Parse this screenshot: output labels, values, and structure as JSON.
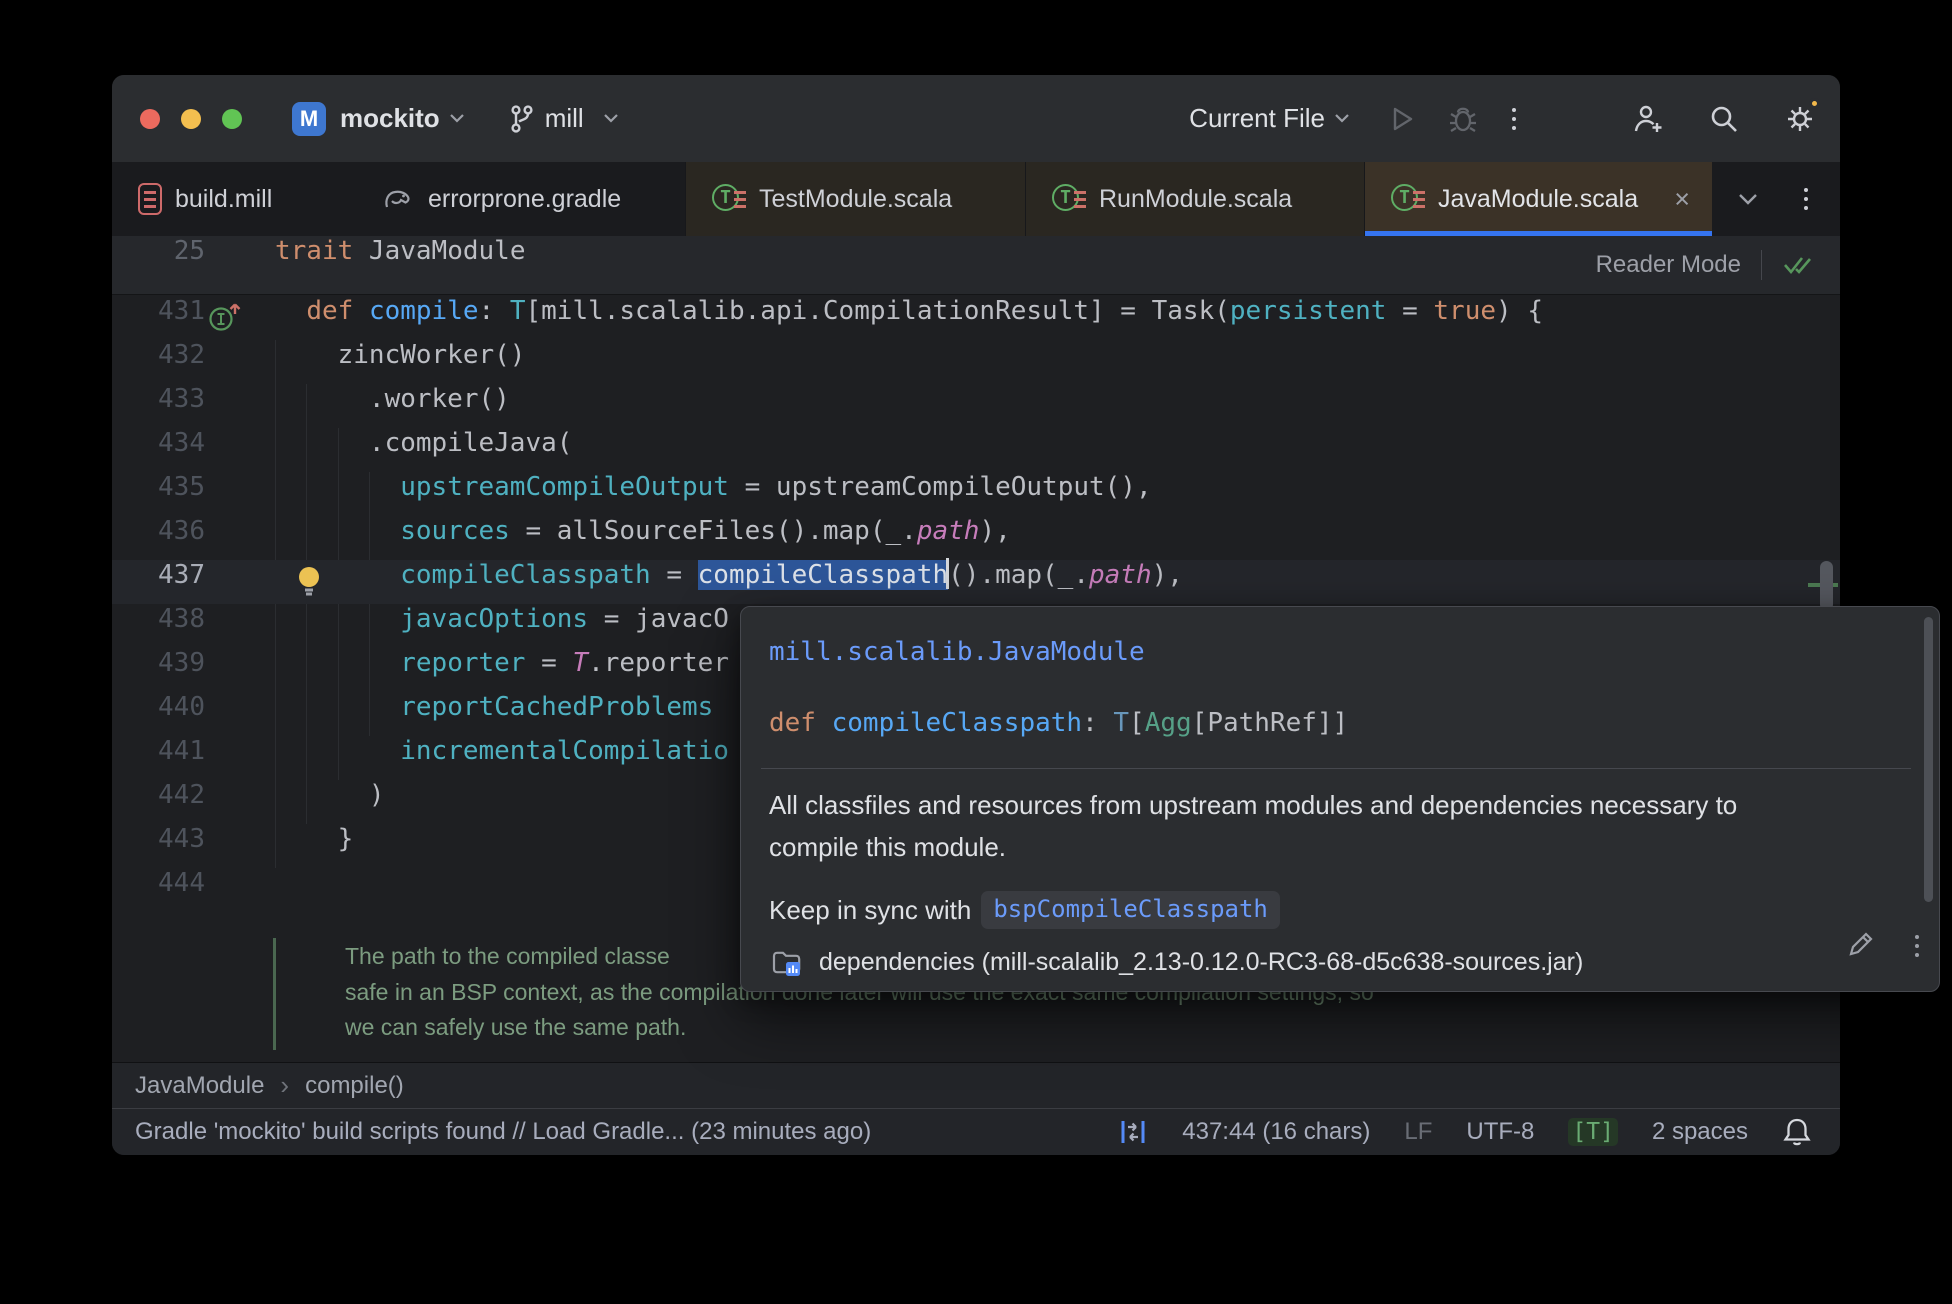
{
  "window": {
    "title_project": "mockito",
    "vcs_branch": "mill",
    "run_config": "Current File"
  },
  "colors": {
    "accent_blue": "#3574F0",
    "selection": "#2D5699",
    "link_blue": "#6B9BFA",
    "scala_green": "#5FAD65",
    "salmon": "#CC7168",
    "notification_dot": "#F2B84B"
  },
  "tabs": {
    "close_glyph": "×",
    "items": [
      {
        "label": "build.mill",
        "icon": "mill-file-icon"
      },
      {
        "label": "errorprone.gradle",
        "icon": "gradle-icon"
      },
      {
        "label": "TestModule.scala",
        "icon": "scala-trait-icon"
      },
      {
        "label": "RunModule.scala",
        "icon": "scala-trait-icon"
      },
      {
        "label": "JavaModule.scala",
        "icon": "scala-trait-icon",
        "active": true
      }
    ]
  },
  "sticky": {
    "line_number": "25",
    "keyword": "trait",
    "name": " JavaModule",
    "reader_mode": "Reader Mode"
  },
  "editor": {
    "lines": [
      {
        "n": "431",
        "gutter": "override-marker",
        "t": [
          [
            "pl",
            "  "
          ],
          [
            "kw",
            "def"
          ],
          [
            "pl",
            " "
          ],
          [
            "fn",
            "compile"
          ],
          [
            "pl",
            ": "
          ],
          [
            "ty",
            "T"
          ],
          [
            "pl",
            "[mill.scalalib.api.CompilationResult] = Task("
          ],
          [
            "nm",
            "persistent"
          ],
          [
            "pl",
            " = "
          ],
          [
            "kw",
            "true"
          ],
          [
            "pl",
            ") {"
          ]
        ]
      },
      {
        "n": "432",
        "t": [
          [
            "pl",
            "    zincWorker()"
          ]
        ]
      },
      {
        "n": "433",
        "t": [
          [
            "pl",
            "      .worker()"
          ]
        ]
      },
      {
        "n": "434",
        "t": [
          [
            "pl",
            "      .compileJava("
          ]
        ]
      },
      {
        "n": "435",
        "t": [
          [
            "pl",
            "        "
          ],
          [
            "nm",
            "upstreamCompileOutput"
          ],
          [
            "pl",
            " = upstreamCompileOutput(),"
          ]
        ]
      },
      {
        "n": "436",
        "t": [
          [
            "pl",
            "        "
          ],
          [
            "nm",
            "sources"
          ],
          [
            "pl",
            " = allSourceFiles().map(_."
          ],
          [
            "it",
            "path"
          ],
          [
            "pl",
            "),"
          ]
        ]
      },
      {
        "n": "437",
        "current": true,
        "gutter": "lightbulb",
        "t": [
          [
            "pl",
            "        "
          ],
          [
            "nm",
            "compileClasspath"
          ],
          [
            "pl",
            " = "
          ],
          [
            "sel",
            "compileClasspath"
          ],
          [
            "cur",
            ""
          ],
          [
            "pl",
            "().map(_."
          ],
          [
            "it",
            "path"
          ],
          [
            "pl",
            "),"
          ]
        ]
      },
      {
        "n": "438",
        "t": [
          [
            "pl",
            "        "
          ],
          [
            "nm",
            "javacOptions"
          ],
          [
            "pl",
            " = javacO"
          ]
        ]
      },
      {
        "n": "439",
        "t": [
          [
            "pl",
            "        "
          ],
          [
            "nm",
            "reporter"
          ],
          [
            "pl",
            " = "
          ],
          [
            "it",
            "T"
          ],
          [
            "pl",
            ".reporter"
          ]
        ]
      },
      {
        "n": "440",
        "t": [
          [
            "pl",
            "        "
          ],
          [
            "nm",
            "reportCachedProblems"
          ]
        ]
      },
      {
        "n": "441",
        "t": [
          [
            "pl",
            "        "
          ],
          [
            "nm",
            "incrementalCompilatio"
          ]
        ]
      },
      {
        "n": "442",
        "t": [
          [
            "pl",
            "      )"
          ]
        ]
      },
      {
        "n": "443",
        "t": [
          [
            "pl",
            "    }"
          ]
        ]
      },
      {
        "n": "444",
        "t": [
          [
            "pl",
            ""
          ]
        ]
      }
    ],
    "doc_comment": [
      "The path to the compiled classe",
      "safe in an BSP context, as the compilation done later will use the exact same compilation settings, so",
      "we can safely use the same path."
    ]
  },
  "popup": {
    "qualified_name": "mill.scalalib.JavaModule",
    "signature": [
      [
        "kw",
        "def"
      ],
      [
        "pl",
        " "
      ],
      [
        "fn",
        "compileClasspath"
      ],
      [
        "pl",
        ": "
      ],
      [
        "tp",
        "T"
      ],
      [
        "pl",
        "["
      ],
      [
        "tg",
        "Agg"
      ],
      [
        "pl",
        "[PathRef]]"
      ]
    ],
    "description_line1": "All classfiles and resources from upstream modules and dependencies necessary to",
    "description_line2": "compile this module.",
    "keep_in_sync_label": "Keep in sync with",
    "keep_in_sync_target": "bspCompileClasspath",
    "source": "dependencies (mill-scalalib_2.13-0.12.0-RC3-68-d5c638-sources.jar)"
  },
  "breadcrumbs": {
    "items": [
      "JavaModule",
      "compile()"
    ],
    "separator": "›"
  },
  "statusbar": {
    "message": "Gradle 'mockito' build scripts found // Load Gradle... (23 minutes ago)",
    "caret_position": "437:44 (16 chars)",
    "line_ending": "LF",
    "encoding": "UTF-8",
    "highlight_badge": "[T]",
    "indent": "2 spaces"
  }
}
